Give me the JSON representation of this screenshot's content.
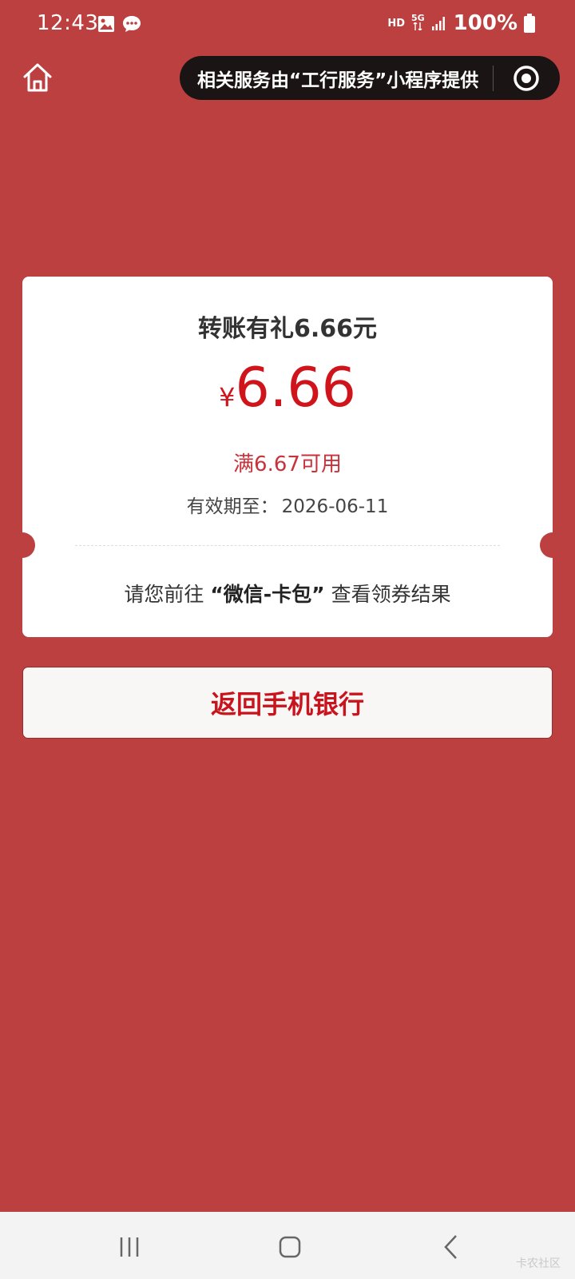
{
  "status_bar": {
    "time": "12:43",
    "hd": "HD",
    "network": "5G",
    "battery": "100%"
  },
  "header": {
    "capsule_text": "相关服务由“工行服务”小程序提供"
  },
  "coupon": {
    "title": "转账有礼6.66元",
    "currency": "¥",
    "amount": "6.66",
    "threshold": "满6.67可用",
    "validity_label": "有效期至：",
    "validity_date": "2026-06-11",
    "hint_prefix": "请您前往",
    "hint_highlight": "“微信-卡包”",
    "hint_suffix": "查看领券结果"
  },
  "actions": {
    "return_label": "返回手机银行"
  },
  "watermark": "卡农社区",
  "colors": {
    "background": "#bd4040",
    "accent_red": "#d0141c",
    "card": "#ffffff",
    "capsule": "#1b1414"
  }
}
